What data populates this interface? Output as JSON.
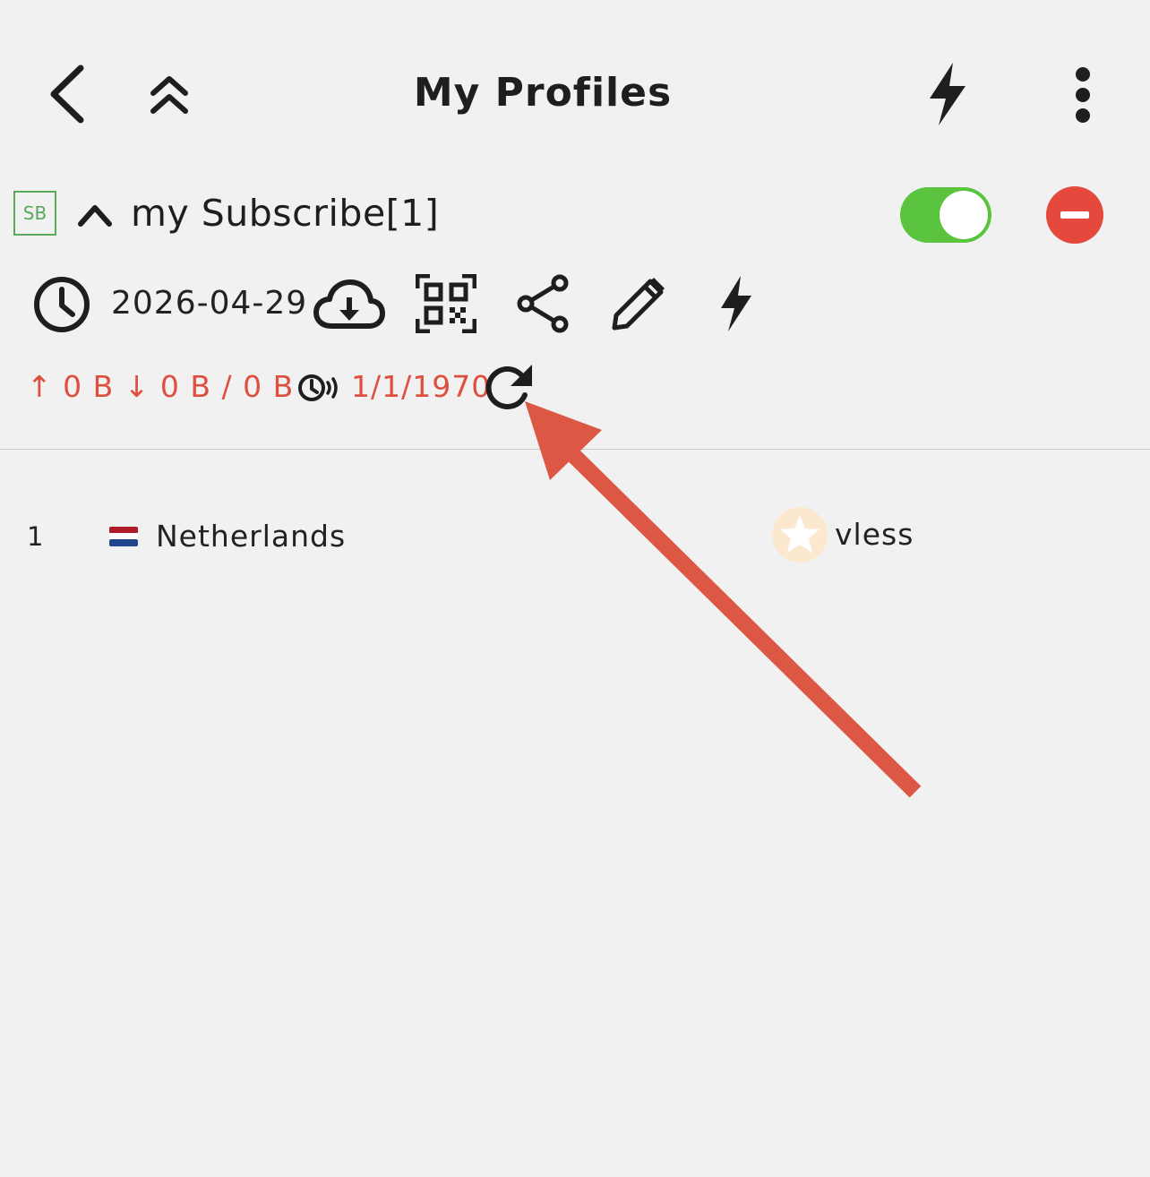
{
  "header": {
    "title": "My Profiles",
    "icons": [
      "back-arrow-icon",
      "double-chevron-up-icon",
      "lightning-icon",
      "more-vertical-icon"
    ]
  },
  "subscription": {
    "badge": "SB",
    "name": "my Subscribe[1]",
    "enabled": true,
    "updated_date": "2026-04-29",
    "traffic_text": "↑ 0 B ↓ 0 B / 0 B",
    "expire_date": "1/1/1970"
  },
  "servers": [
    {
      "index": "1",
      "flag": "netherlands-flag-icon",
      "name": "Netherlands",
      "protocol": "vless"
    }
  ],
  "colors": {
    "background": "#f1f1f1",
    "toggle_on": "#5ac43e",
    "remove": "#e5483d",
    "traffic": "#de4f3f",
    "badge": "#5aa85a",
    "annotation_arrow": "#dc5744"
  }
}
